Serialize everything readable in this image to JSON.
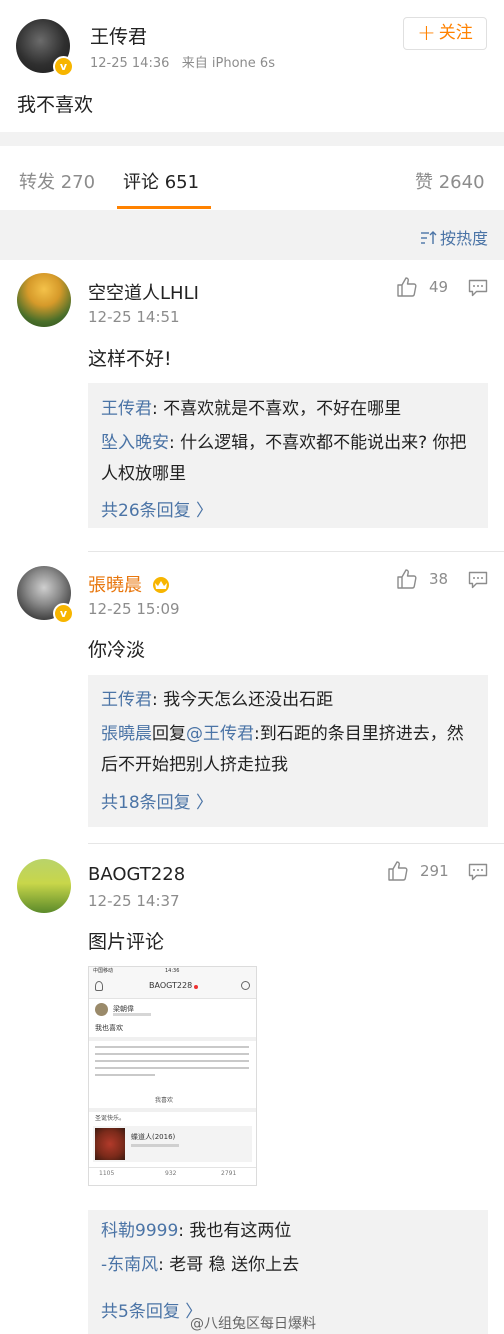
{
  "post": {
    "author": "王传君",
    "time": "12-25 14:36",
    "source": "来自 iPhone 6s",
    "follow_label": "关注",
    "text": "我不喜欢",
    "verified_icon": "v-badge-icon"
  },
  "tabs": {
    "repost": "转发 270",
    "comments": "评论 651",
    "likes": "赞 2640"
  },
  "sort": {
    "label": "按热度"
  },
  "comments": [
    {
      "name": "空空道人LHLI",
      "time": "12-25 14:51",
      "likes": "49",
      "text": "这样不好!",
      "replies": [
        {
          "name": "王传君",
          "text": ": 不喜欢就是不喜欢，不好在哪里"
        },
        {
          "name": "坠入晚安",
          "text": ": 什么逻辑，不喜欢都不能说出来? 你把人权放哪里"
        }
      ],
      "more": "共26条回复 〉"
    },
    {
      "name": "張曉晨",
      "time": "12-25 15:09",
      "likes": "38",
      "text": "你冷淡",
      "replies": [
        {
          "name": "王传君",
          "text": ": 我今天怎么还没出石距"
        },
        {
          "name": "張曉晨",
          "mid": "回复",
          "at": "@王传君",
          "text": ":到石距的条目里挤进去，然后不开始把别人挤走拉我"
        }
      ],
      "more": "共18条回复 〉"
    },
    {
      "name": "BAOGT228",
      "time": "12-25 14:37",
      "likes": "291",
      "text": "图片评论",
      "replies": [
        {
          "name": "科勒9999",
          "text": ": 我也有这两位"
        },
        {
          "name": "-东南风",
          "text": ": 老哥 稳 送你上去"
        }
      ],
      "more": "共5条回复 〉"
    }
  ],
  "image_comment": {
    "status_carrier": "中国移动",
    "status_time": "14:36",
    "title": "BAOGT228",
    "inner_name": "梁朝偉",
    "inner_post": "我也喜欢",
    "inner_like_label": "我喜欢",
    "inner_footer": "圣诞快乐。",
    "inner_card_title": "蝶道人(2016)",
    "inner_stat_1": "1105",
    "inner_stat_2": "932",
    "inner_stat_3": "2791"
  },
  "watermark": "@八组兔区每日爆料",
  "colors": {
    "accent": "#ff8200",
    "link": "#4b74a6",
    "gray_bg": "#f2f2f2"
  }
}
